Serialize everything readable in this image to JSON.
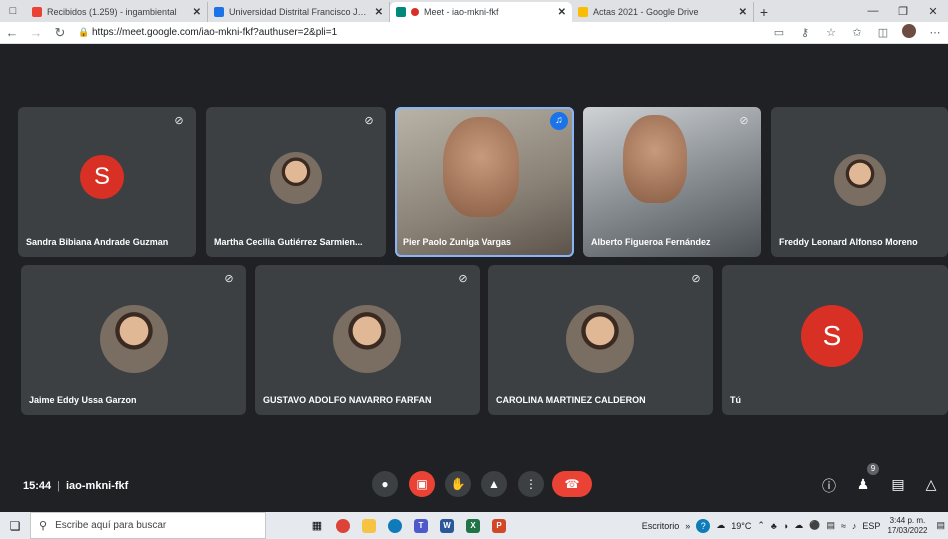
{
  "browser": {
    "tabs": [
      {
        "title": "Recibidos (1.259) - ingambiental",
        "favicon_color": "#ea4335",
        "active": false
      },
      {
        "title": "Universidad Distrital Francisco José",
        "favicon_color": "#1a73e8",
        "active": false
      },
      {
        "title": "Meet - iao-mkni-fkf",
        "favicon_color": "#00897b",
        "active": true
      },
      {
        "title": "Actas 2021 - Google Drive",
        "favicon_color": "#fbbc04",
        "active": false
      }
    ],
    "url": "https://meet.google.com/iao-mkni-fkf?authuser=2&pli=1"
  },
  "meet": {
    "code": "iao-mkni-fkf",
    "time": "15:44",
    "participants_count": "9",
    "participants": [
      {
        "name": "Sandra Bibiana Andrade Guzman",
        "kind": "letter",
        "letter": "S",
        "muted": true
      },
      {
        "name": "Martha Cecilia Gutiérrez Sarmien...",
        "kind": "photo",
        "muted": true
      },
      {
        "name": "Pier Paolo Zuniga Vargas",
        "kind": "video",
        "muted": false,
        "speaking": true
      },
      {
        "name": "Alberto Figueroa Fernández",
        "kind": "video",
        "muted": true
      },
      {
        "name": "Freddy Leonard Alfonso Moreno",
        "kind": "photo",
        "muted": false
      },
      {
        "name": "Jaime Eddy Ussa Garzon",
        "kind": "photo",
        "muted": true
      },
      {
        "name": "GUSTAVO ADOLFO NAVARRO FARFAN",
        "kind": "photo",
        "muted": true
      },
      {
        "name": "CAROLINA MARTINEZ CALDERON",
        "kind": "photo",
        "muted": true
      },
      {
        "name": "Tú",
        "kind": "letter",
        "letter": "S",
        "muted": false
      }
    ]
  },
  "taskbar": {
    "search_placeholder": "Escribe aquí para buscar",
    "desktop_label": "Escritorio",
    "weather": "19°C",
    "lang": "ESP",
    "clock_time": "3:44 p. m.",
    "clock_date": "17/03/2022"
  }
}
